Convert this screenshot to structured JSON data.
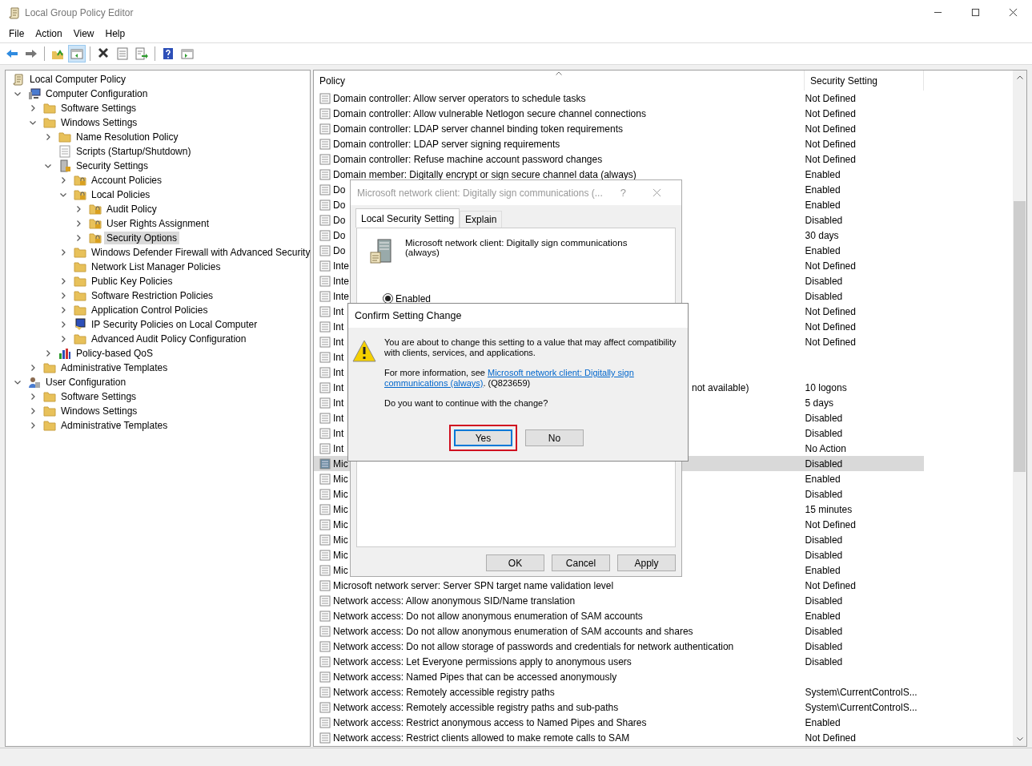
{
  "window": {
    "title": "Local Group Policy Editor"
  },
  "menu": [
    "File",
    "Action",
    "View",
    "Help"
  ],
  "toolbar": [
    {
      "kind": "back",
      "selected": false
    },
    {
      "kind": "forward",
      "selected": false
    },
    {
      "kind": "up",
      "selected": false
    },
    {
      "kind": "tree",
      "selected": true
    },
    {
      "kind": "delete",
      "selected": false
    },
    {
      "kind": "properties",
      "selected": false
    },
    {
      "kind": "export",
      "selected": false
    },
    {
      "kind": "help",
      "selected": false
    },
    {
      "kind": "view",
      "selected": false
    }
  ],
  "tree": [
    {
      "label": "Local Computer Policy",
      "kind": "scroll",
      "selected": false,
      "children": [
        {
          "label": "Computer Configuration",
          "kind": "computer",
          "selected": false,
          "expanded": true,
          "children": [
            {
              "label": "Software Settings",
              "kind": "folder",
              "selected": false,
              "expanded": false
            },
            {
              "label": "Windows Settings",
              "kind": "folder",
              "selected": false,
              "expanded": true,
              "children": [
                {
                  "label": "Name Resolution Policy",
                  "kind": "folder",
                  "selected": false,
                  "expanded": false
                },
                {
                  "label": "Scripts (Startup/Shutdown)",
                  "kind": "script",
                  "selected": false
                },
                {
                  "label": "Security Settings",
                  "kind": "security",
                  "selected": false,
                  "expanded": true,
                  "children": [
                    {
                      "label": "Account Policies",
                      "kind": "lock",
                      "selected": false,
                      "expanded": false
                    },
                    {
                      "label": "Local Policies",
                      "kind": "lock",
                      "selected": false,
                      "expanded": true,
                      "children": [
                        {
                          "label": "Audit Policy",
                          "kind": "lock",
                          "selected": false,
                          "expanded": false
                        },
                        {
                          "label": "User Rights Assignment",
                          "kind": "lock",
                          "selected": false,
                          "expanded": false
                        },
                        {
                          "label": "Security Options",
                          "kind": "lock",
                          "selected": true,
                          "expanded": false
                        }
                      ]
                    },
                    {
                      "label": "Windows Defender Firewall with Advanced Security",
                      "kind": "folder",
                      "selected": false,
                      "expanded": false
                    },
                    {
                      "label": "Network List Manager Policies",
                      "kind": "folder",
                      "selected": false
                    },
                    {
                      "label": "Public Key Policies",
                      "kind": "folder",
                      "selected": false,
                      "expanded": false
                    },
                    {
                      "label": "Software Restriction Policies",
                      "kind": "folder",
                      "selected": false,
                      "expanded": false
                    },
                    {
                      "label": "Application Control Policies",
                      "kind": "folder",
                      "selected": false,
                      "expanded": false
                    },
                    {
                      "label": "IP Security Policies on Local Computer",
                      "kind": "ip",
                      "selected": false,
                      "expanded": false
                    },
                    {
                      "label": "Advanced Audit Policy Configuration",
                      "kind": "folder",
                      "selected": false,
                      "expanded": false
                    }
                  ]
                },
                {
                  "label": "Policy-based QoS",
                  "kind": "qos",
                  "selected": false,
                  "expanded": false
                }
              ]
            },
            {
              "label": "Administrative Templates",
              "kind": "folder",
              "selected": false,
              "expanded": false
            }
          ]
        },
        {
          "label": "User Configuration",
          "kind": "user",
          "selected": false,
          "expanded": true,
          "children": [
            {
              "label": "Software Settings",
              "kind": "folder",
              "selected": false,
              "expanded": false
            },
            {
              "label": "Windows Settings",
              "kind": "folder",
              "selected": false,
              "expanded": false
            },
            {
              "label": "Administrative Templates",
              "kind": "folder",
              "selected": false,
              "expanded": false
            }
          ]
        }
      ]
    }
  ],
  "table": {
    "columns": [
      "Policy",
      "Security Setting"
    ],
    "rows": [
      {
        "policy": "Domain controller: Allow server operators to schedule tasks",
        "setting": "Not Defined",
        "selected": false
      },
      {
        "policy": "Domain controller: Allow vulnerable Netlogon secure channel connections",
        "setting": "Not Defined",
        "selected": false
      },
      {
        "policy": "Domain controller: LDAP server channel binding token requirements",
        "setting": "Not Defined",
        "selected": false
      },
      {
        "policy": "Domain controller: LDAP server signing requirements",
        "setting": "Not Defined",
        "selected": false
      },
      {
        "policy": "Domain controller: Refuse machine account password changes",
        "setting": "Not Defined",
        "selected": false
      },
      {
        "policy": "Domain member: Digitally encrypt or sign secure channel data (always)",
        "setting": "Enabled",
        "selected": false
      },
      {
        "policy": "Do",
        "setting": "Enabled",
        "selected": false
      },
      {
        "policy": "Do",
        "setting": "Enabled",
        "selected": false
      },
      {
        "policy": "Do",
        "setting": "Disabled",
        "selected": false
      },
      {
        "policy": "Do",
        "setting": "30 days",
        "selected": false
      },
      {
        "policy": "Do",
        "setting": "Enabled",
        "selected": false
      },
      {
        "policy": "Inte",
        "setting": "Not Defined",
        "selected": false
      },
      {
        "policy": "Inte",
        "setting": "Disabled",
        "selected": false
      },
      {
        "policy": "Inte",
        "setting": "Disabled",
        "selected": false
      },
      {
        "policy": "Int",
        "setting": "Not Defined",
        "selected": false
      },
      {
        "policy": "Int",
        "setting": "Not Defined",
        "selected": false
      },
      {
        "policy": "Int",
        "setting": "Not Defined",
        "selected": false
      },
      {
        "policy": "Int",
        "selected": false
      },
      {
        "policy": "Int",
        "selected": false
      },
      {
        "policy": "Int",
        "policy_tail": "not available)",
        "setting": "10 logons",
        "selected": false
      },
      {
        "policy": "Int",
        "setting": "5 days",
        "selected": false
      },
      {
        "policy": "Int",
        "setting": "Disabled",
        "selected": false
      },
      {
        "policy": "Int",
        "setting": "Disabled",
        "selected": false
      },
      {
        "policy": "Int",
        "setting": "No Action",
        "selected": false
      },
      {
        "policy": "Mic",
        "setting": "Disabled",
        "selected": true
      },
      {
        "policy": "Mic",
        "setting": "Enabled",
        "selected": false
      },
      {
        "policy": "Mic",
        "setting": "Disabled",
        "selected": false
      },
      {
        "policy": "Mic",
        "setting": "15 minutes",
        "selected": false
      },
      {
        "policy": "Mic",
        "setting": "Not Defined",
        "selected": false
      },
      {
        "policy": "Mic",
        "setting": "Disabled",
        "selected": false
      },
      {
        "policy": "Mic",
        "setting": "Disabled",
        "selected": false
      },
      {
        "policy": "Mic",
        "setting": "Enabled",
        "selected": false
      },
      {
        "policy": "Microsoft network server: Server SPN target name validation level",
        "setting": "Not Defined",
        "selected": false
      },
      {
        "policy": "Network access: Allow anonymous SID/Name translation",
        "setting": "Disabled",
        "selected": false
      },
      {
        "policy": "Network access: Do not allow anonymous enumeration of SAM accounts",
        "setting": "Enabled",
        "selected": false
      },
      {
        "policy": "Network access: Do not allow anonymous enumeration of SAM accounts and shares",
        "setting": "Disabled",
        "selected": false
      },
      {
        "policy": "Network access: Do not allow storage of passwords and credentials for network authentication",
        "setting": "Disabled",
        "selected": false
      },
      {
        "policy": "Network access: Let Everyone permissions apply to anonymous users",
        "setting": "Disabled",
        "selected": false
      },
      {
        "policy": "Network access: Named Pipes that can be accessed anonymously",
        "selected": false
      },
      {
        "policy": "Network access: Remotely accessible registry paths",
        "setting": "System\\CurrentControlS...",
        "selected": false
      },
      {
        "policy": "Network access: Remotely accessible registry paths and sub-paths",
        "setting": "System\\CurrentControlS...",
        "selected": false
      },
      {
        "policy": "Network access: Restrict anonymous access to Named Pipes and Shares",
        "setting": "Enabled",
        "selected": false
      },
      {
        "policy": "Network access: Restrict clients allowed to make remote calls to SAM",
        "setting": "Not Defined",
        "selected": false
      }
    ]
  },
  "properties_dialog": {
    "title": "Microsoft network client: Digitally sign communications (...",
    "help": "?",
    "tabs": [
      {
        "label": "Local Security Setting",
        "selected": true
      },
      {
        "label": "Explain",
        "selected": false
      }
    ],
    "policy_name": "Microsoft network client: Digitally sign communications (always)",
    "options": [
      {
        "label": "Enabled",
        "checked": true
      }
    ],
    "buttons": [
      "OK",
      "Cancel",
      "Apply"
    ]
  },
  "confirm_dialog": {
    "title": "Confirm Setting Change",
    "message": "You are about to change this setting to a value that may affect compatibility with clients, services, and applications.",
    "info_prefix": "For more information, see",
    "link_lines": [
      "Microsoft network client: Digitally sign",
      "communications (always)"
    ],
    "info_suffix": ". (Q823659)",
    "question": "Do you want to continue with the change?",
    "buttons": [
      {
        "label": "Yes",
        "focused": true,
        "highlighted": true
      },
      {
        "label": "No",
        "focused": false,
        "highlighted": false
      }
    ]
  }
}
